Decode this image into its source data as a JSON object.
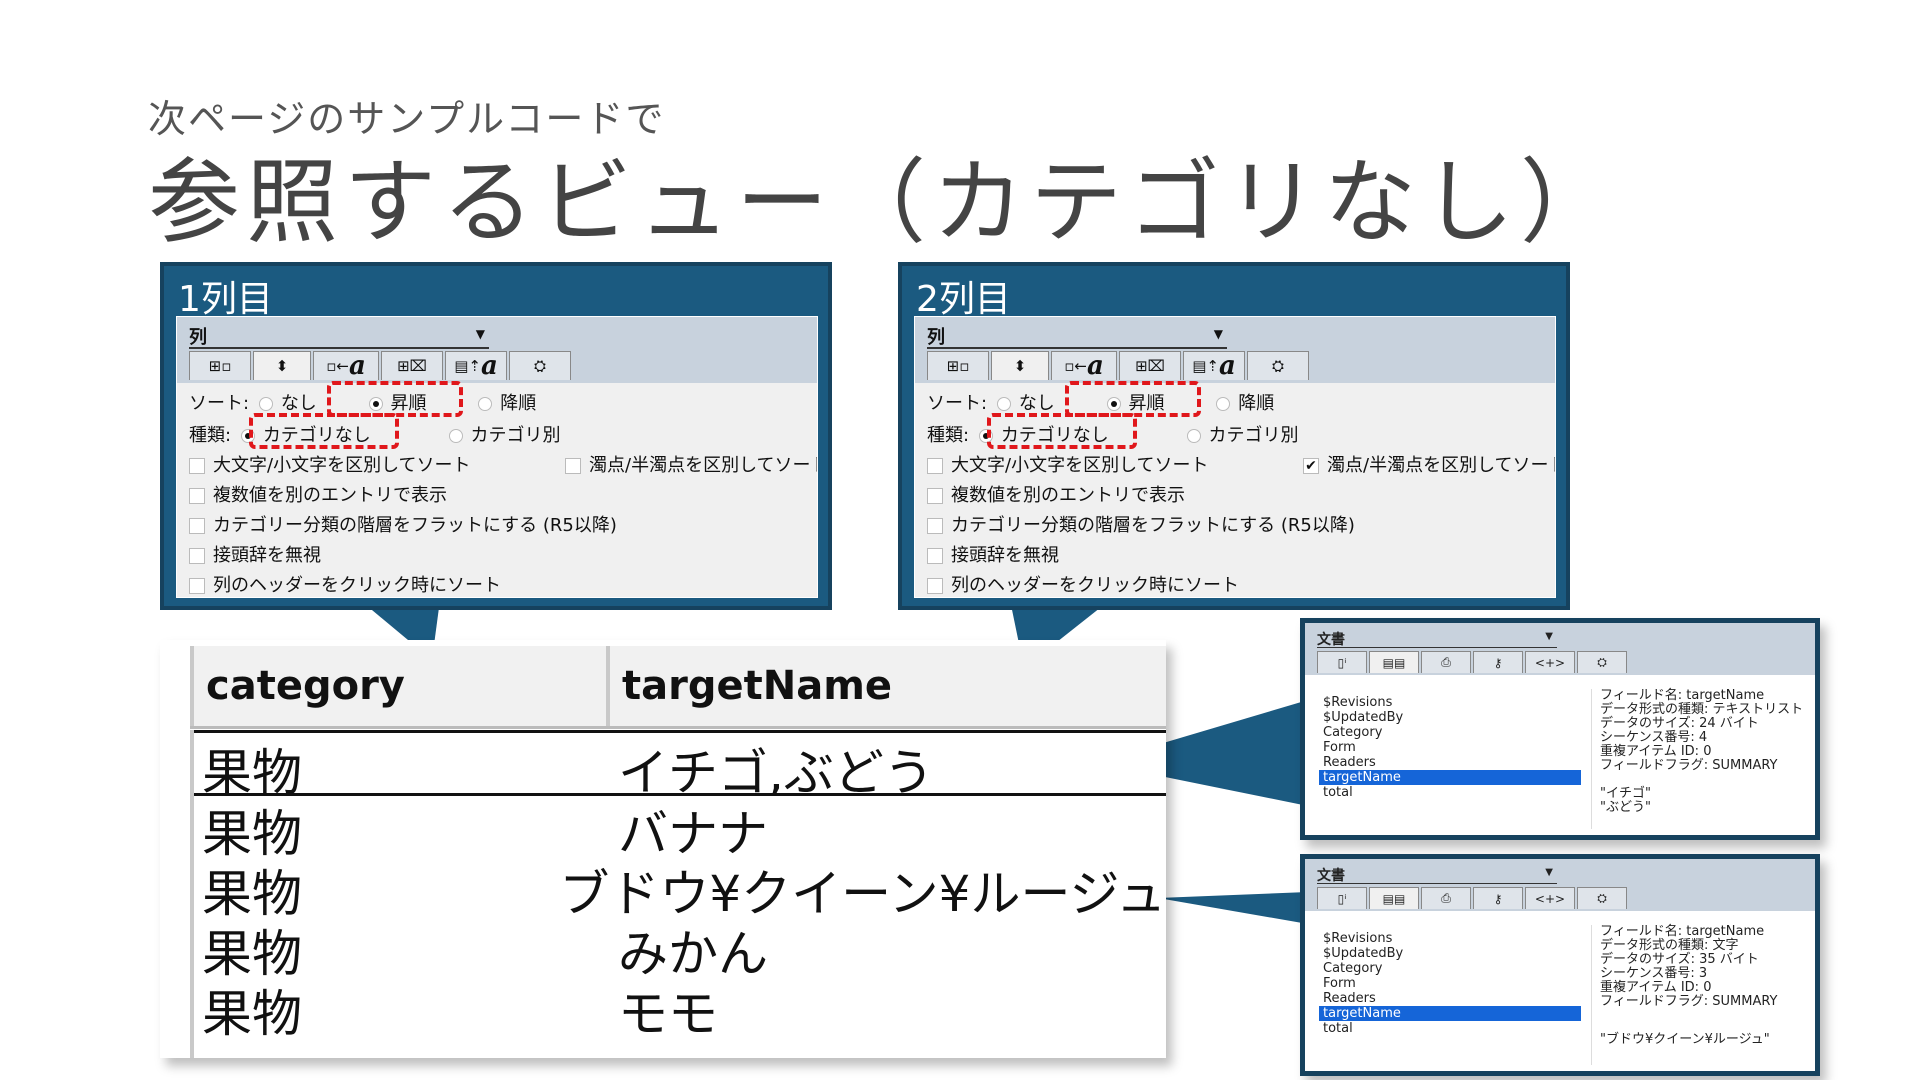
{
  "slide": {
    "subtitle": "次ページのサンプルコードで",
    "title": "参照するビュー（カテゴリなし）"
  },
  "column_panels": [
    {
      "heading": "1列目",
      "combo": "列",
      "sort_label": "ソート:",
      "sort_options": [
        "なし",
        "昇順",
        "降順"
      ],
      "sort_selected": "昇順",
      "type_label": "種類:",
      "type_options": [
        "カテゴリなし",
        "カテゴリ別"
      ],
      "type_selected": "カテゴリなし",
      "checkboxes": [
        {
          "label": "大文字/小文字を区別してソート",
          "checked": false
        },
        {
          "label": "濁点/半濁点を区別してソート",
          "checked": false
        },
        {
          "label": "複数値を別のエントリで表示",
          "checked": false
        },
        {
          "label": "カテゴリー分類の階層をフラットにする (R5以降)",
          "checked": false
        },
        {
          "label": "接頭辞を無視",
          "checked": false
        },
        {
          "label": "列のヘッダーをクリック時にソート",
          "checked": false
        }
      ]
    },
    {
      "heading": "2列目",
      "combo": "列",
      "sort_label": "ソート:",
      "sort_options": [
        "なし",
        "昇順",
        "降順"
      ],
      "sort_selected": "昇順",
      "type_label": "種類:",
      "type_options": [
        "カテゴリなし",
        "カテゴリ別"
      ],
      "type_selected": "カテゴリなし",
      "checkboxes": [
        {
          "label": "大文字/小文字を区別してソート",
          "checked": false
        },
        {
          "label": "濁点/半濁点を区別してソート",
          "checked": true
        },
        {
          "label": "複数値を別のエントリで表示",
          "checked": false
        },
        {
          "label": "カテゴリー分類の階層をフラットにする (R5以降)",
          "checked": false
        },
        {
          "label": "接頭辞を無視",
          "checked": false
        },
        {
          "label": "列のヘッダーをクリック時にソート",
          "checked": false
        }
      ]
    }
  ],
  "view_table": {
    "headers": [
      "category",
      "targetName"
    ],
    "rows": [
      [
        "果物",
        "イチゴ,ぶどう"
      ],
      [
        "果物",
        "バナナ"
      ],
      [
        "果物",
        "ブドウ¥クイーン¥ルージュ"
      ],
      [
        "果物",
        "みかん"
      ],
      [
        "果物",
        "モモ"
      ]
    ]
  },
  "doc_dialogs": [
    {
      "combo": "文書",
      "fields": [
        "$Revisions",
        "$UpdatedBy",
        "Category",
        "Form",
        "Readers",
        "targetName",
        "total"
      ],
      "selected_field": "targetName",
      "info": [
        "フィールド名: targetName",
        "データ形式の種類: テキストリスト",
        "データのサイズ: 24 バイト",
        "シーケンス番号: 4",
        "重複アイテム ID: 0",
        "フィールドフラグ: SUMMARY"
      ],
      "value_lines": [
        "\"イチゴ\"",
        "\"ぶどう\""
      ]
    },
    {
      "combo": "文書",
      "fields": [
        "$Revisions",
        "$UpdatedBy",
        "Category",
        "Form",
        "Readers",
        "targetName",
        "total"
      ],
      "selected_field": "targetName",
      "info": [
        "フィールド名: targetName",
        "データ形式の種類: 文字",
        "データのサイズ: 35 バイト",
        "シーケンス番号: 3",
        "重複アイテム ID: 0",
        "フィールドフラグ: SUMMARY"
      ],
      "value_lines": [
        "\"ブドウ¥クイーン¥ルージュ\""
      ]
    }
  ]
}
